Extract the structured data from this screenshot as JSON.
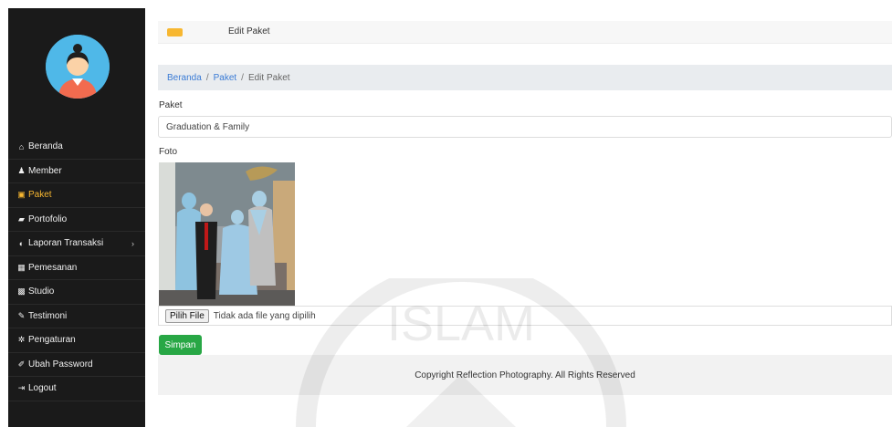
{
  "sidebar": {
    "avatar_icon": "user-avatar-icon",
    "items": [
      {
        "icon": "home-icon",
        "label": "Beranda",
        "active": false
      },
      {
        "icon": "user-icon",
        "label": "Member",
        "active": false
      },
      {
        "icon": "image-icon",
        "label": "Paket",
        "active": true
      },
      {
        "icon": "book-icon",
        "label": "Portofolio",
        "active": false
      },
      {
        "icon": "globe-icon",
        "label": "Laporan Transaksi",
        "active": false,
        "has_submenu": true
      },
      {
        "icon": "calendar-icon",
        "label": "Pemesanan",
        "active": false
      },
      {
        "icon": "photo-icon",
        "label": "Studio",
        "active": false
      },
      {
        "icon": "pencil-icon",
        "label": "Testimoni",
        "active": false
      },
      {
        "icon": "gear-icon",
        "label": "Pengaturan",
        "active": false
      },
      {
        "icon": "edit-icon",
        "label": "Ubah Password",
        "active": false
      },
      {
        "icon": "logout-icon",
        "label": "Logout",
        "active": false
      }
    ]
  },
  "topbar": {
    "title": "Edit Paket"
  },
  "breadcrumb": {
    "home": "Beranda",
    "sep1": "/",
    "parent": "Paket",
    "sep2": "/",
    "current": "Edit Paket"
  },
  "form": {
    "paket_label": "Paket",
    "paket_value": "Graduation & Family",
    "foto_label": "Foto",
    "file_button": "Pilih File",
    "file_status": "Tidak ada file yang dipilih",
    "save_label": "Simpan"
  },
  "footer": {
    "text": "Copyright Reflection Photography. All Rights Reserved"
  },
  "watermark": {
    "text": "ISLAM"
  },
  "colors": {
    "sidebar_bg": "#1a1a1a",
    "active": "#f7b731",
    "link": "#3a7bd5",
    "save": "#28a745"
  }
}
